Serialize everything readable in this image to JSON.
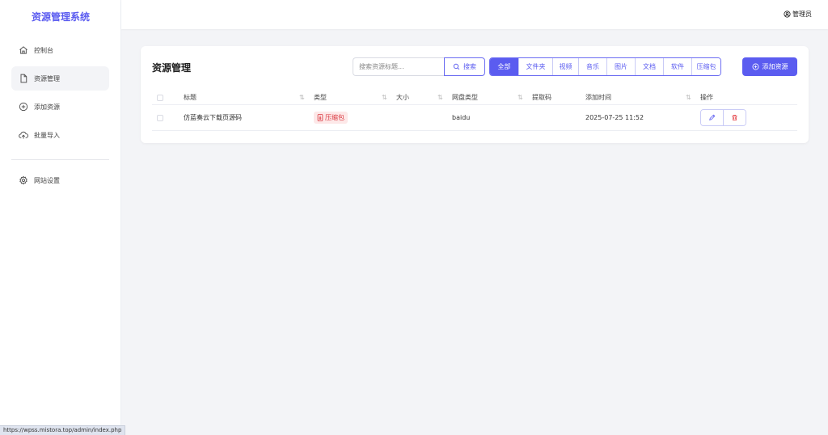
{
  "app": {
    "title": "资源管理系统"
  },
  "sidebar": {
    "items": [
      {
        "label": "控制台",
        "icon": "home-icon"
      },
      {
        "label": "资源管理",
        "icon": "file-icon",
        "active": true
      },
      {
        "label": "添加资源",
        "icon": "plus-circle-icon"
      },
      {
        "label": "批量导入",
        "icon": "cloud-upload-icon"
      },
      {
        "label": "网站设置",
        "icon": "gear-icon"
      }
    ]
  },
  "header": {
    "user": "管理员",
    "user_icon": "user-circle-icon"
  },
  "main": {
    "title": "资源管理",
    "search": {
      "placeholder": "搜索资源标题...",
      "button_label": "搜索",
      "value": ""
    },
    "filters": [
      {
        "label": "全部",
        "active": true
      },
      {
        "label": "文件夹"
      },
      {
        "label": "视频"
      },
      {
        "label": "音乐"
      },
      {
        "label": "图片"
      },
      {
        "label": "文档"
      },
      {
        "label": "软件"
      },
      {
        "label": "压缩包"
      }
    ],
    "add_button_label": "添加资源",
    "table": {
      "columns": [
        "标题",
        "类型",
        "大小",
        "网盘类型",
        "提取码",
        "添加时间",
        "操作"
      ],
      "rows": [
        {
          "title": "仿蓝奏云下载页源码",
          "type": "压缩包",
          "size": "",
          "disk_type": "baidu",
          "code": "",
          "added": "2025-07-25 11:52"
        }
      ]
    }
  },
  "statusbar": {
    "url": "https://wpss.mistora.top/admin/index.php"
  },
  "colors": {
    "accent": "#5b5cf0",
    "badge_bg": "#fde8e8",
    "badge_text": "#d9363e",
    "danger": "#e5484d"
  }
}
